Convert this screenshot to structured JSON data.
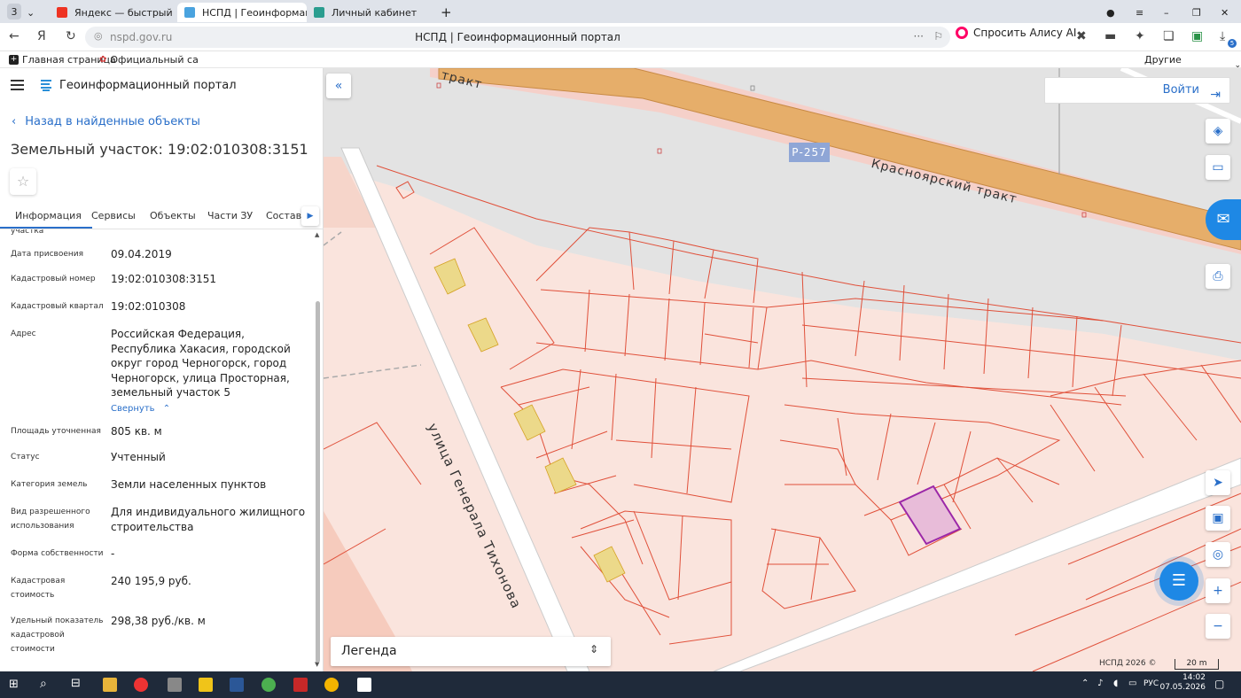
{
  "browser": {
    "tab_counter": "3",
    "tabs": [
      {
        "label": "Яндекс — быстрый поиск",
        "active": false
      },
      {
        "label": "НСПД | Геоинформац",
        "active": true
      },
      {
        "label": "Личный кабинет",
        "active": false
      }
    ],
    "url_domain": "nspd.gov.ru",
    "page_title": "НСПД | Геоинформационный портал",
    "alice_label": "Спросить Алису AI",
    "bookmarks": [
      "Главная страница",
      "Официальный са"
    ],
    "other_bookmarks": "Другие закладки",
    "download_badge": "5"
  },
  "sidebar": {
    "portal_title": "Геоинформационный портал",
    "back_link": "Назад в найденные объекты",
    "parcel_title": "Земельный участок: 19:02:010308:3151",
    "tabs": [
      "Информация",
      "Сервисы",
      "Объекты",
      "Части ЗУ",
      "Состав"
    ],
    "cut_label": "участка",
    "rows": [
      {
        "label": "Дата присвоения",
        "value": "09.04.2019"
      },
      {
        "label": "Кадастровый номер",
        "value": "19:02:010308:3151"
      },
      {
        "label": "Кадастровый квартал",
        "value": "19:02:010308"
      },
      {
        "label": "Адрес",
        "value": "Российская Федерация, Республика Хакасия, городской округ город Черногорск, город Черногорск, улица Просторная, земельный участок 5"
      },
      {
        "label": "Площадь уточненная",
        "value": "805 кв. м"
      },
      {
        "label": "Статус",
        "value": "Учтенный"
      },
      {
        "label": "Категория земель",
        "value": "Земли населенных пунктов"
      },
      {
        "label": "Вид разрешенного использования",
        "value": "Для индивидуального жилищного строительства"
      },
      {
        "label": "Форма собственности",
        "value": "-"
      },
      {
        "label": "Кадастровая стоимость",
        "value": "240 195,9 руб."
      },
      {
        "label": "Удельный показатель кадастровой стоимости",
        "value": "298,38 руб./кв. м"
      }
    ],
    "collapse_link": "Свернуть"
  },
  "map": {
    "login": "Войти",
    "road_label": "Красноярский тракт",
    "road_label_top": "тракт",
    "route_badge": "Р-257",
    "street_label": "улица Генерала Тихонова",
    "legend": "Легенда",
    "copyright": "НСПД 2026 ©",
    "scale": "20 m",
    "zoom_in": "+",
    "zoom_out": "−",
    "colors": {
      "parcel_fill": "#f9e1da",
      "parcel_line": "#e0503a",
      "selected_fill": "#e8bcd9",
      "selected_line": "#9b27a8",
      "building": "#ecd98a",
      "road": "#e5ab6a",
      "accent": "#2a6fc9"
    }
  },
  "taskbar": {
    "time": "14:02",
    "date": "07.05.2026",
    "lang": "РУС"
  }
}
